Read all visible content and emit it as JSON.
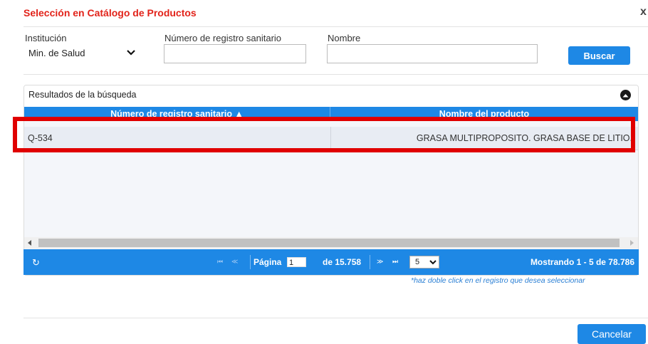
{
  "dialog": {
    "title": "Selección en Catálogo de Productos",
    "close_label": "x"
  },
  "filters": {
    "institucion_label": "Institución",
    "institucion_value": "Min. de Salud",
    "registro_label": "Número de registro sanitario",
    "registro_value": "",
    "nombre_label": "Nombre",
    "nombre_value": "",
    "buscar_label": "Buscar"
  },
  "results": {
    "title": "Resultados de la búsqueda",
    "columns": [
      "Número de registro sanitario ▲",
      "Nombre del producto"
    ],
    "rows": [
      {
        "registro": "Q-534",
        "nombre": "GRASA MULTIPROPOSITO. GRASA  BASE DE LITIO."
      }
    ]
  },
  "pager": {
    "page_label": "Página",
    "page_value": "1",
    "of_label": "de 15.758",
    "page_size": "5",
    "showing": "Mostrando 1 - 5 de 78.786"
  },
  "hint": "*haz doble click en el registro que desea seleccionar",
  "footer": {
    "cancel_label": "Cancelar"
  },
  "colors": {
    "accent": "#1e88e5",
    "title": "#e2231a",
    "highlight": "#e00000"
  }
}
